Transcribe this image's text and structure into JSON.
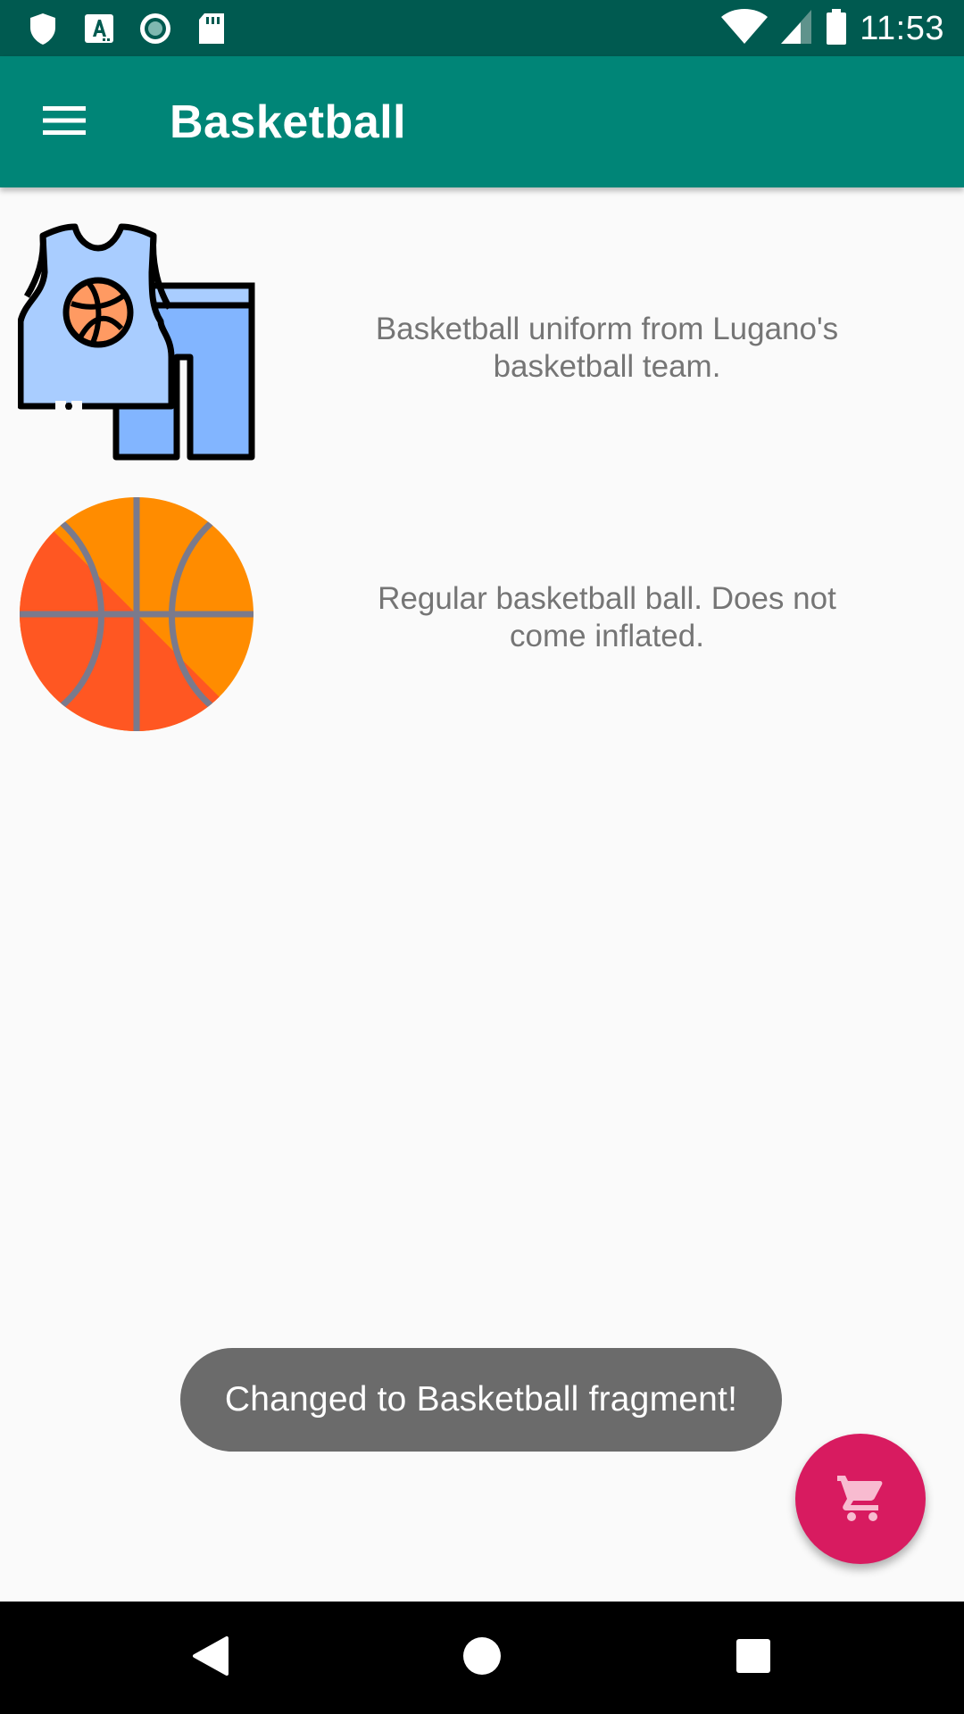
{
  "status_bar": {
    "time": "11:53",
    "left_icons": [
      "shield-icon",
      "accessibility-a-icon",
      "record-icon",
      "sd-card-icon"
    ],
    "right_icons": [
      "wifi-icon",
      "cellular-signal-icon",
      "battery-icon"
    ]
  },
  "app_bar": {
    "title": "Basketball",
    "menu_icon": "hamburger-menu-icon",
    "background": "#008577"
  },
  "products": [
    {
      "icon": "basketball-uniform-icon",
      "description": "Basketball uniform from Lugano's basketball team."
    },
    {
      "icon": "basketball-ball-icon",
      "description": "Regular basketball ball. Does not come inflated."
    }
  ],
  "toast": {
    "text": "Changed to Basketball fragment!"
  },
  "fab": {
    "icon": "shopping-cart-icon",
    "color": "#d81b60"
  },
  "navigation_bar": {
    "buttons": [
      "back-icon",
      "home-icon",
      "recents-icon"
    ]
  }
}
